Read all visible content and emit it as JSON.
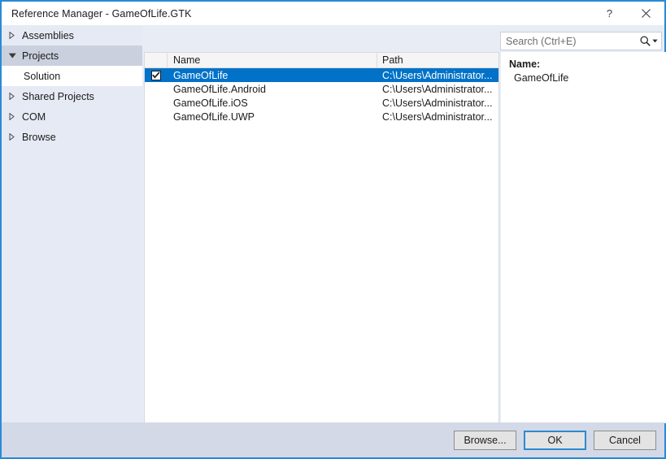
{
  "window": {
    "title": "Reference Manager - GameOfLife.GTK",
    "help_label": "?",
    "close_label": "✕",
    "accent_color": "#2a8ad4"
  },
  "sidebar": {
    "items": [
      {
        "label": "Assemblies",
        "state": "collapsed",
        "selected": false,
        "child": false
      },
      {
        "label": "Projects",
        "state": "expanded",
        "selected": true,
        "child": false
      },
      {
        "label": "Solution",
        "state": "leaf",
        "selected": false,
        "child": true
      },
      {
        "label": "Shared Projects",
        "state": "collapsed",
        "selected": false,
        "child": false
      },
      {
        "label": "COM",
        "state": "collapsed",
        "selected": false,
        "child": false
      },
      {
        "label": "Browse",
        "state": "collapsed",
        "selected": false,
        "child": false
      }
    ]
  },
  "search": {
    "placeholder": "Search (Ctrl+E)",
    "value": "",
    "icon": "search-icon",
    "dropdown_icon": "chevron-down-icon"
  },
  "list": {
    "columns": [
      "",
      "Name",
      "Path"
    ],
    "rows": [
      {
        "checked": true,
        "name": "GameOfLife",
        "path": "C:\\Users\\Administrator...",
        "selected": true
      },
      {
        "checked": false,
        "name": "GameOfLife.Android",
        "path": "C:\\Users\\Administrator...",
        "selected": false
      },
      {
        "checked": false,
        "name": "GameOfLife.iOS",
        "path": "C:\\Users\\Administrator...",
        "selected": false
      },
      {
        "checked": false,
        "name": "GameOfLife.UWP",
        "path": "C:\\Users\\Administrator...",
        "selected": false
      }
    ]
  },
  "detail": {
    "name_label": "Name:",
    "name_value": "GameOfLife"
  },
  "footer": {
    "browse_label": "Browse...",
    "ok_label": "OK",
    "cancel_label": "Cancel"
  }
}
